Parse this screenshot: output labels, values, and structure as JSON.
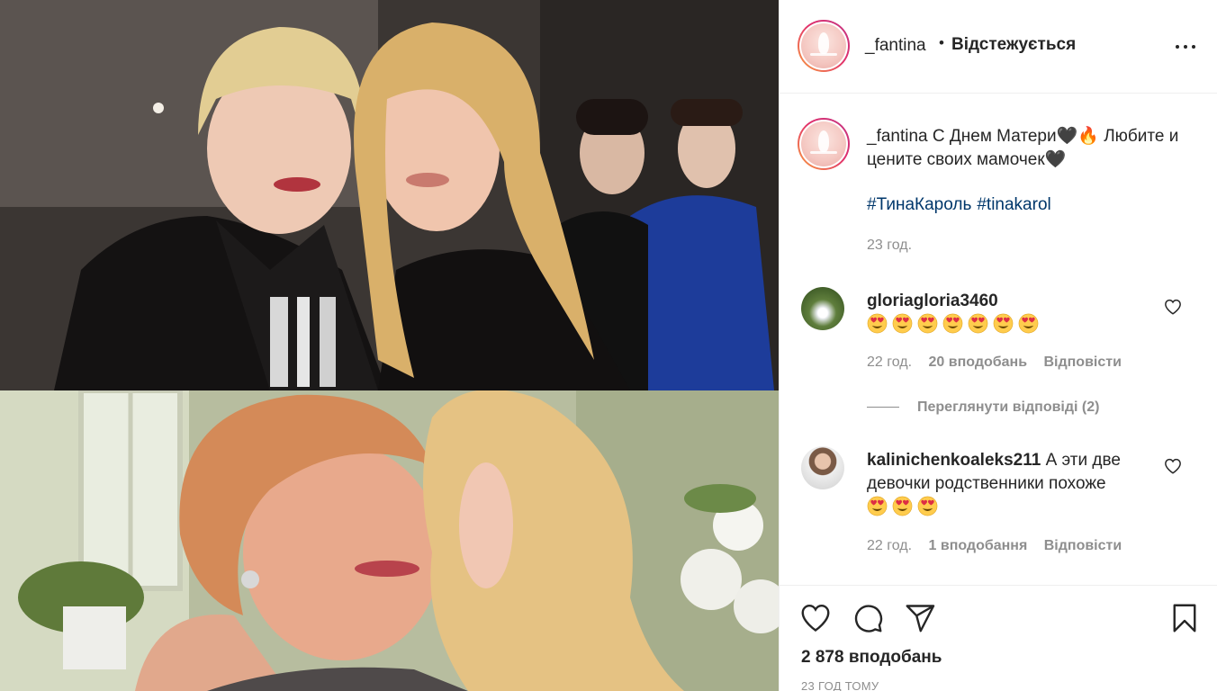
{
  "post": {
    "username": "_fantina",
    "separator": "•",
    "follow_status": "Відстежується",
    "caption_text": "С Днем Матери🖤🔥 Любите и цените своих мамочек🖤",
    "hashtags": [
      "#ТинаКароль",
      "#tinakarol"
    ],
    "caption_time": "23 год.",
    "likes": "2 878 вподобань",
    "posted_ago": "23 ГОД ТОМУ"
  },
  "comments": [
    {
      "username": "gloriagloria3460",
      "text": "",
      "emoji_count": 7,
      "time": "22 год.",
      "likes": "20 вподобань",
      "reply": "Відповісти",
      "view_replies": "Переглянути відповіді (2)"
    },
    {
      "username": "kalinichenkoaleks211",
      "text": "А эти две девочки родственники похоже",
      "emoji_count": 3,
      "time": "22 год.",
      "likes": "1 вподобання",
      "reply": "Відповісти"
    }
  ],
  "icons": {
    "more": "more-options-icon",
    "like": "heart-icon",
    "comment": "comment-icon",
    "share": "share-icon",
    "save": "bookmark-icon",
    "emoji": "heart-eyes-emoji"
  },
  "colors": {
    "hashtag": "#00376b",
    "muted": "#8e8e8e",
    "story_ring_start": "#f9a03f",
    "story_ring_end": "#c13584"
  }
}
